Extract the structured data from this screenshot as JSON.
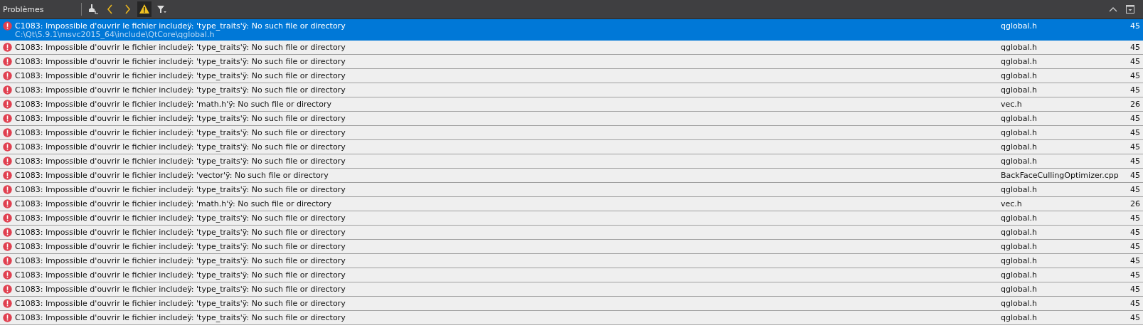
{
  "panel": {
    "title": "Problèmes"
  },
  "toolbar": [
    {
      "kind": "clean",
      "on": false
    },
    {
      "kind": "prev",
      "on": false
    },
    {
      "kind": "next",
      "on": false
    },
    {
      "kind": "warnings",
      "on": true
    },
    {
      "kind": "filter",
      "on": false
    }
  ],
  "rows": [
    {
      "message": "C1083: Impossible d'ouvrir le fichier includeÿ: 'type_traits'ÿ: No such file or directory",
      "path": "C:\\Qt\\5.9.1\\msvc2015_64\\include\\QtCore\\qglobal.h",
      "file": "qglobal.h",
      "line": "45",
      "selected": true
    },
    {
      "message": "C1083: Impossible d'ouvrir le fichier includeÿ: 'type_traits'ÿ: No such file or directory",
      "file": "qglobal.h",
      "line": "45",
      "selected": false
    },
    {
      "message": "C1083: Impossible d'ouvrir le fichier includeÿ: 'type_traits'ÿ: No such file or directory",
      "file": "qglobal.h",
      "line": "45",
      "selected": false
    },
    {
      "message": "C1083: Impossible d'ouvrir le fichier includeÿ: 'type_traits'ÿ: No such file or directory",
      "file": "qglobal.h",
      "line": "45",
      "selected": false
    },
    {
      "message": "C1083: Impossible d'ouvrir le fichier includeÿ: 'type_traits'ÿ: No such file or directory",
      "file": "qglobal.h",
      "line": "45",
      "selected": false
    },
    {
      "message": "C1083: Impossible d'ouvrir le fichier includeÿ: 'math.h'ÿ: No such file or directory",
      "file": "vec.h",
      "line": "26",
      "selected": false
    },
    {
      "message": "C1083: Impossible d'ouvrir le fichier includeÿ: 'type_traits'ÿ: No such file or directory",
      "file": "qglobal.h",
      "line": "45",
      "selected": false
    },
    {
      "message": "C1083: Impossible d'ouvrir le fichier includeÿ: 'type_traits'ÿ: No such file or directory",
      "file": "qglobal.h",
      "line": "45",
      "selected": false
    },
    {
      "message": "C1083: Impossible d'ouvrir le fichier includeÿ: 'type_traits'ÿ: No such file or directory",
      "file": "qglobal.h",
      "line": "45",
      "selected": false
    },
    {
      "message": "C1083: Impossible d'ouvrir le fichier includeÿ: 'type_traits'ÿ: No such file or directory",
      "file": "qglobal.h",
      "line": "45",
      "selected": false
    },
    {
      "message": "C1083: Impossible d'ouvrir le fichier includeÿ: 'vector'ÿ: No such file or directory",
      "file": "BackFaceCullingOptimizer.cpp",
      "line": "45",
      "selected": false
    },
    {
      "message": "C1083: Impossible d'ouvrir le fichier includeÿ: 'type_traits'ÿ: No such file or directory",
      "file": "qglobal.h",
      "line": "45",
      "selected": false
    },
    {
      "message": "C1083: Impossible d'ouvrir le fichier includeÿ: 'math.h'ÿ: No such file or directory",
      "file": "vec.h",
      "line": "26",
      "selected": false
    },
    {
      "message": "C1083: Impossible d'ouvrir le fichier includeÿ: 'type_traits'ÿ: No such file or directory",
      "file": "qglobal.h",
      "line": "45",
      "selected": false
    },
    {
      "message": "C1083: Impossible d'ouvrir le fichier includeÿ: 'type_traits'ÿ: No such file or directory",
      "file": "qglobal.h",
      "line": "45",
      "selected": false
    },
    {
      "message": "C1083: Impossible d'ouvrir le fichier includeÿ: 'type_traits'ÿ: No such file or directory",
      "file": "qglobal.h",
      "line": "45",
      "selected": false
    },
    {
      "message": "C1083: Impossible d'ouvrir le fichier includeÿ: 'type_traits'ÿ: No such file or directory",
      "file": "qglobal.h",
      "line": "45",
      "selected": false
    },
    {
      "message": "C1083: Impossible d'ouvrir le fichier includeÿ: 'type_traits'ÿ: No such file or directory",
      "file": "qglobal.h",
      "line": "45",
      "selected": false
    },
    {
      "message": "C1083: Impossible d'ouvrir le fichier includeÿ: 'type_traits'ÿ: No such file or directory",
      "file": "qglobal.h",
      "line": "45",
      "selected": false
    },
    {
      "message": "C1083: Impossible d'ouvrir le fichier includeÿ: 'type_traits'ÿ: No such file or directory",
      "file": "qglobal.h",
      "line": "45",
      "selected": false
    },
    {
      "message": "C1083: Impossible d'ouvrir le fichier includeÿ: 'type_traits'ÿ: No such file or directory",
      "file": "qglobal.h",
      "line": "45",
      "selected": false
    }
  ]
}
